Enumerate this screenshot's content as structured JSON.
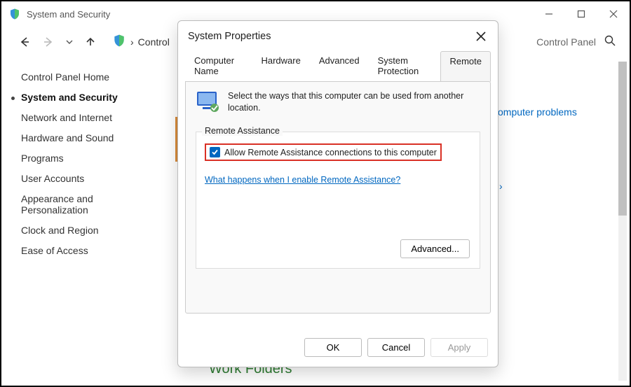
{
  "window": {
    "title": "System and Security"
  },
  "breadcrumb": {
    "item1": "Control",
    "search_label": "Control Panel"
  },
  "sidebar": {
    "items": [
      {
        "label": "Control Panel Home"
      },
      {
        "label": "System and Security"
      },
      {
        "label": "Network and Internet"
      },
      {
        "label": "Hardware and Sound"
      },
      {
        "label": "Programs"
      },
      {
        "label": "User Accounts"
      },
      {
        "label": "Appearance and Personalization"
      },
      {
        "label": "Clock and Region"
      },
      {
        "label": "Ease of Access"
      }
    ]
  },
  "content": {
    "peek_link": "omputer problems",
    "work_folders": "Work Folders"
  },
  "dialog": {
    "title": "System Properties",
    "tabs": {
      "t0": "Computer Name",
      "t1": "Hardware",
      "t2": "Advanced",
      "t3": "System Protection",
      "t4": "Remote"
    },
    "intro": "Select the ways that this computer can be used from another location.",
    "group_label": "Remote Assistance",
    "checkbox_label": "Allow Remote Assistance connections to this computer",
    "checkbox_checked": true,
    "help_link": "What happens when I enable Remote Assistance?",
    "advanced_btn": "Advanced...",
    "buttons": {
      "ok": "OK",
      "cancel": "Cancel",
      "apply": "Apply"
    }
  }
}
